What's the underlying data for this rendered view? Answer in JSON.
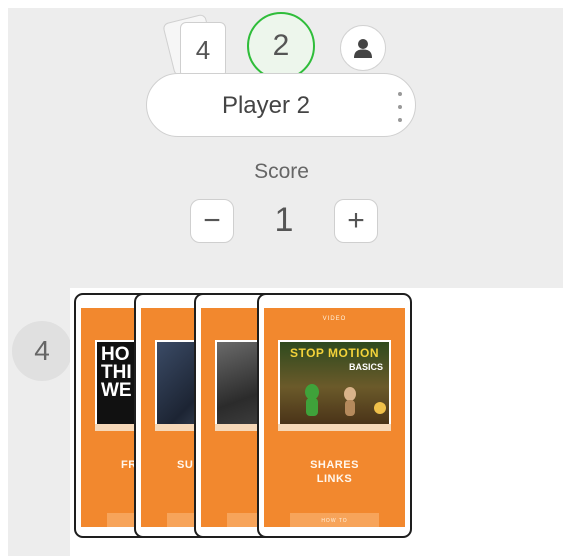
{
  "deck": {
    "count": "4",
    "icon": "card-stack-icon"
  },
  "turn": {
    "number": "2",
    "accent": "#2fbd3a"
  },
  "avatar": {
    "icon": "person-icon"
  },
  "player": {
    "name": "Player 2",
    "menu_icon": "kebab-menu-icon"
  },
  "score": {
    "label": "Score",
    "value": "1",
    "decrement_label": "−",
    "increment_label": "+"
  },
  "hand": {
    "count": "4",
    "cards": [
      {
        "id": "card-1",
        "color": "#f2882e",
        "thumb_text": [
          "HO",
          "THI",
          "WE"
        ],
        "title": [
          "FR"
        ]
      },
      {
        "id": "card-2",
        "color": "#f2882e",
        "thumb_text": [],
        "title": [
          "SU"
        ]
      },
      {
        "id": "card-3",
        "color": "#f2882e",
        "thumb_text": [],
        "title": []
      },
      {
        "id": "card-4",
        "color": "#f2882e",
        "top_label": "VIDEO",
        "thumb_text": [
          "STOP MOTION",
          "BASICS"
        ],
        "title": [
          "SHARES",
          "LINKS"
        ],
        "bottom_label": "HOW TO"
      }
    ]
  }
}
